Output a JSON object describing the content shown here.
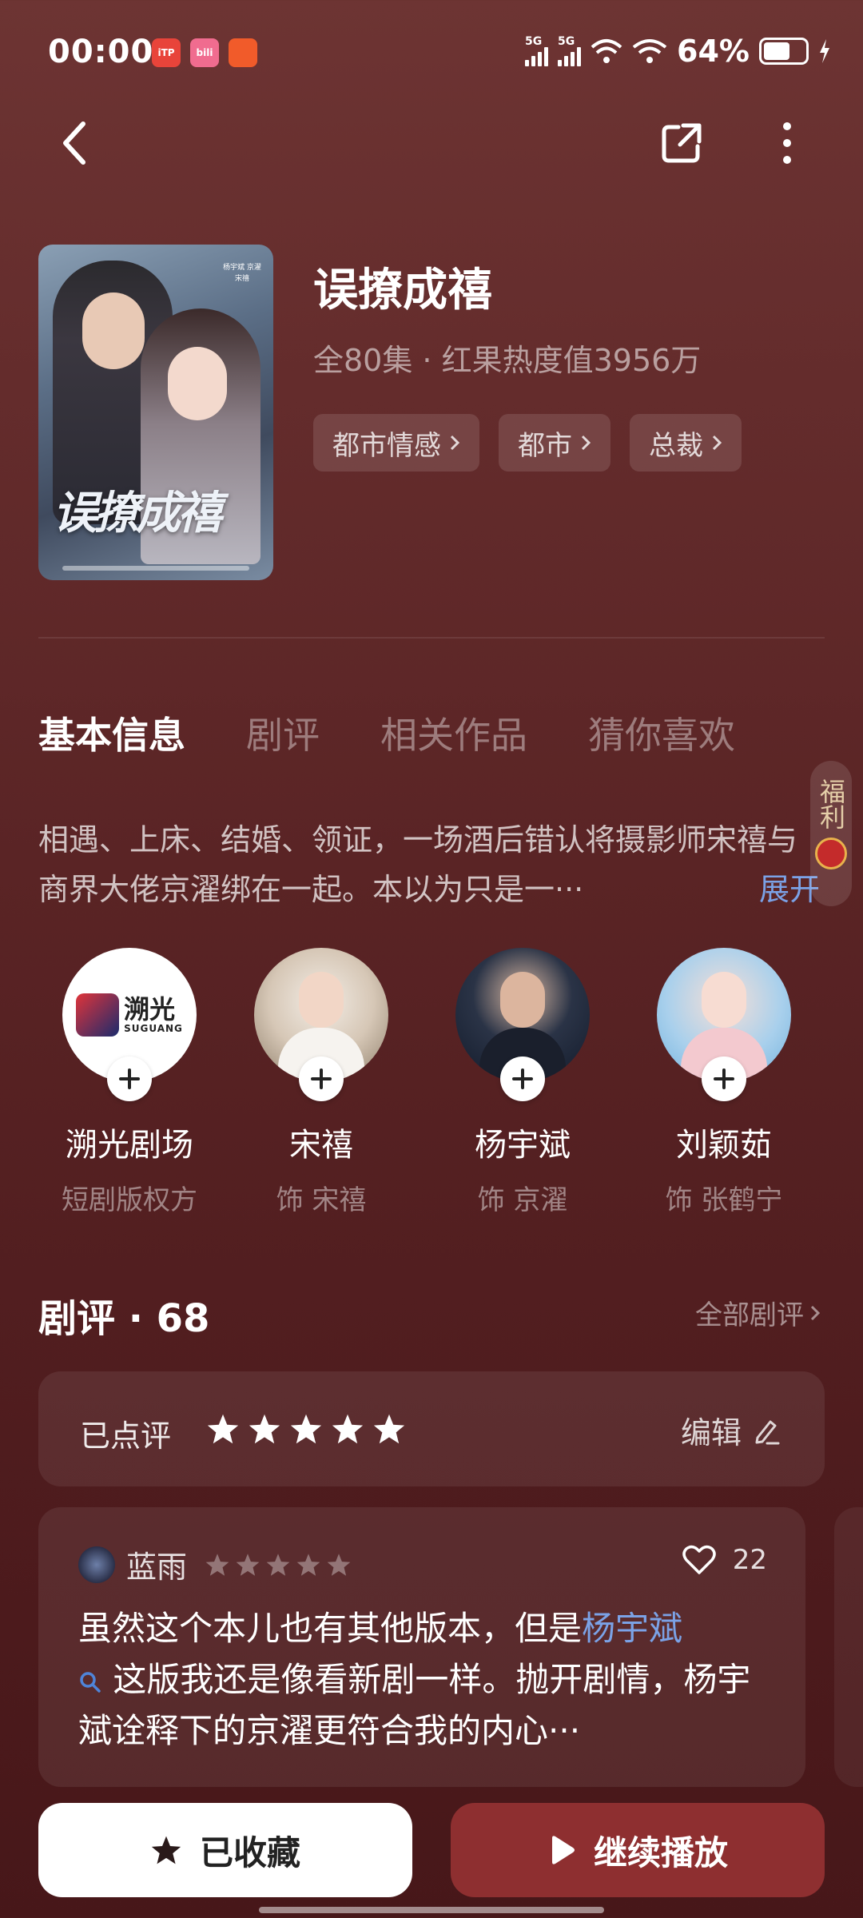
{
  "status_bar": {
    "time": "00:00",
    "apps": [
      {
        "icon": "app-icon-1",
        "color": "#e8443a",
        "label": "iTP"
      },
      {
        "icon": "app-icon-2",
        "color": "#f06c8f",
        "label": "bili"
      },
      {
        "icon": "app-icon-3",
        "color": "#f15b2a",
        "label": ""
      }
    ],
    "network_1": "5G",
    "network_2": "5G",
    "battery_text": "64%",
    "battery_level": 0.64
  },
  "nav": {
    "back_icon": "chevron-left-icon",
    "share_icon": "share-icon",
    "more_icon": "more-vertical-icon"
  },
  "drama": {
    "title": "误撩成禧",
    "meta": "全80集 · 红果热度值3956万",
    "tags": [
      {
        "label": "都市情感"
      },
      {
        "label": "都市"
      },
      {
        "label": "总裁"
      }
    ],
    "poster": {
      "title_art": "误撩成禧",
      "credits": "杨宇斌 京濯 宋禧"
    }
  },
  "tabs": [
    {
      "label": "基本信息",
      "active": true
    },
    {
      "label": "剧评",
      "active": false
    },
    {
      "label": "相关作品",
      "active": false
    },
    {
      "label": "猜你喜欢",
      "active": false
    }
  ],
  "synopsis": {
    "text": "相遇、上床、结婚、领证，一场酒后错认将摄影师宋禧与商界大佬京濯绑在一起。本以为只是一···",
    "expand_label": "展开"
  },
  "fuli": {
    "label": "福利"
  },
  "cast": [
    {
      "name": "溯光剧场",
      "role": "短剧版权方",
      "logo_text": "溯光",
      "logo_sub": "SUGUANG"
    },
    {
      "name": "宋禧",
      "role": "饰 宋禧"
    },
    {
      "name": "杨宇斌",
      "role": "饰 京濯"
    },
    {
      "name": "刘颖茹",
      "role": "饰 张鹤宁"
    }
  ],
  "reviews": {
    "title": "剧评 · 68",
    "all_label": "全部剧评",
    "my_rating": {
      "label": "已点评",
      "stars": 5,
      "edit_label": "编辑"
    },
    "items": [
      {
        "user": "蓝雨",
        "stars": 5,
        "likes": "22",
        "text_before": "虽然这个本儿也有其他版本，但是",
        "highlight": "杨宇斌",
        "text_after": " 这版我还是像看新剧一样。抛开剧情，杨宇斌诠释下的京濯更符合我的内心···"
      }
    ]
  },
  "bottom": {
    "collect_label": "已收藏",
    "play_label": "继续播放"
  },
  "colors": {
    "accent_link": "#7ba2e6",
    "play_button": "#8e2f30",
    "star_muted": "rgba(255,255,255,0.35)"
  }
}
